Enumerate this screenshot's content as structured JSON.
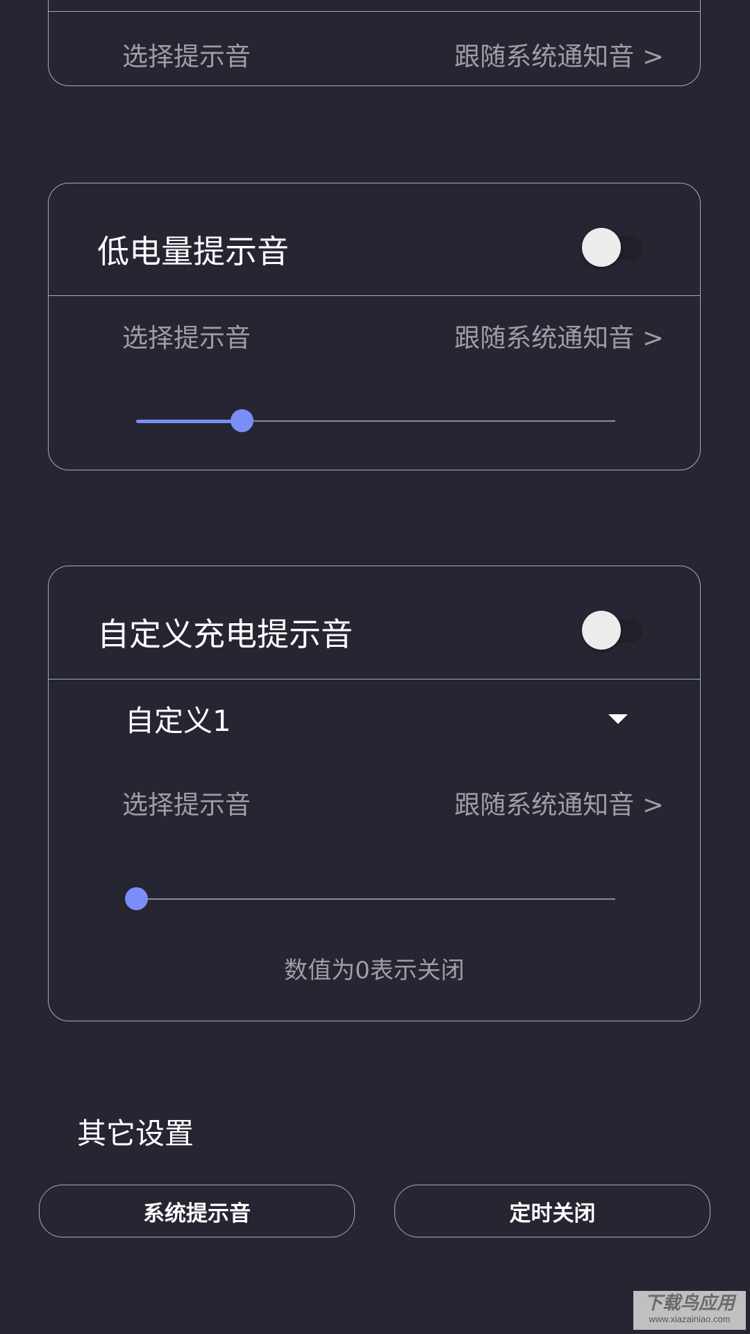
{
  "top_card": {
    "row_label": "选择提示音",
    "row_value": "跟随系统通知音 >"
  },
  "low_battery_card": {
    "title": "低电量提示音",
    "toggle_on": false,
    "row_label": "选择提示音",
    "row_value": "跟随系统通知音 >",
    "slider_fraction": 0.22
  },
  "custom_charge_card": {
    "title": "自定义充电提示音",
    "toggle_on": false,
    "dropdown_value": "自定义1",
    "row_label": "选择提示音",
    "row_value": "跟随系统通知音 >",
    "slider_fraction": 0.0,
    "hint": "数值为0表示关闭"
  },
  "other_settings": {
    "title": "其它设置",
    "buttons": [
      "系统提示音",
      "定时关闭"
    ]
  },
  "watermark": {
    "main": "下载鸟应用",
    "sub": "www.xiazainiao.com"
  },
  "colors": {
    "background": "#252632",
    "accent": "#7b8ef7",
    "border": "#a9abb8",
    "muted_text": "#9d9ea8"
  }
}
